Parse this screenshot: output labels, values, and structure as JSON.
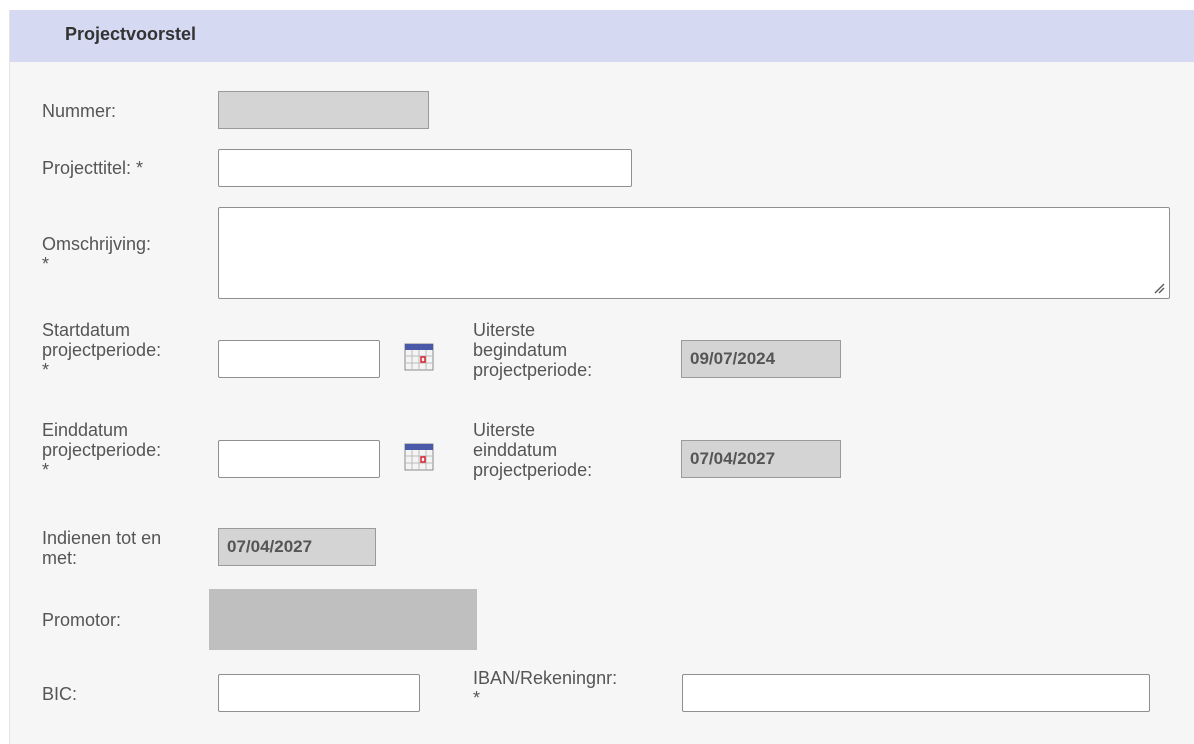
{
  "panel": {
    "title": "Projectvoorstel"
  },
  "fields": {
    "nummer": {
      "label": "Nummer:",
      "value": ""
    },
    "projecttitel": {
      "label": "Projecttitel: *",
      "value": ""
    },
    "omschrijving": {
      "label_line1": "Omschrijving:",
      "label_line2": "*",
      "value": ""
    },
    "startdatum": {
      "label_line1": "Startdatum",
      "label_line2": "projectperiode:",
      "label_line3": "*",
      "value": ""
    },
    "uiterste_begindatum": {
      "label_line1": "Uiterste",
      "label_line2": "begindatum",
      "label_line3": "projectperiode:",
      "value": "09/07/2024"
    },
    "einddatum": {
      "label_line1": "Einddatum",
      "label_line2": "projectperiode:",
      "label_line3": "*",
      "value": ""
    },
    "uiterste_einddatum": {
      "label_line1": "Uiterste",
      "label_line2": "einddatum",
      "label_line3": "projectperiode:",
      "value": "07/04/2027"
    },
    "indienen": {
      "label_line1": "Indienen tot en",
      "label_line2": "met:",
      "value": "07/04/2027"
    },
    "promotor": {
      "label": "Promotor:"
    },
    "bic": {
      "label": "BIC:",
      "value": ""
    },
    "iban": {
      "label_line1": "IBAN/Rekeningnr:",
      "label_line2": "*",
      "value": ""
    }
  },
  "icons": {
    "calendar": "calendar-icon",
    "resize": "resize-grip-icon"
  },
  "colors": {
    "header_bg": "#d6d9f2",
    "panel_bg": "#f6f6f7",
    "readonly_bg": "#d4d4d4",
    "promotor_bg": "#bfbfbf"
  }
}
